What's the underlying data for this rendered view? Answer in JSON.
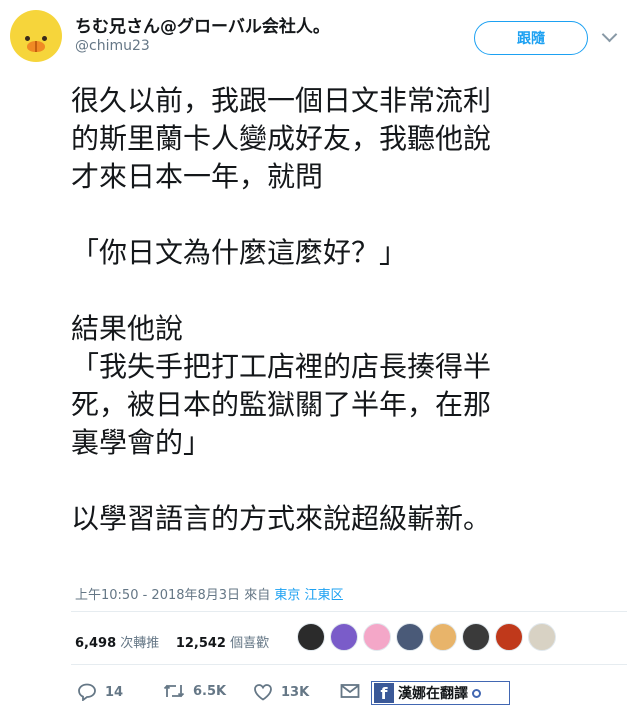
{
  "tweet": {
    "author_name": "ちむ兄さん@グローバル会社人。",
    "author_handle": "@chimu23",
    "follow_label": "跟隨",
    "body": "很久以前，我跟一個日文非常流利\n的斯里蘭卡人變成好友，我聽他說\n才來日本一年，就問\n\n「你日文為什麼這麼好？」\n\n結果他說\n「我失手把打工店裡的店長揍得半\n死，被日本的監獄關了半年，在那\n裏學會的」\n\n以學習語言的方式來說超級嶄新。",
    "timestamp": "上午10:50 - 2018年8月3日",
    "from_label": "來自",
    "location": "東京 江東区"
  },
  "stats": {
    "retweets_count": "6,498",
    "retweets_label": "次轉推",
    "likes_count": "12,542",
    "likes_label": "個喜歡"
  },
  "likers": [
    "#2b2b2b",
    "#7a5cc9",
    "#f4a7c8",
    "#4a5a78",
    "#e8b46a",
    "#3a3a3a",
    "#c0391b",
    "#d8d2c4"
  ],
  "actions": {
    "reply_count": "14",
    "retweet_count": "6.5K",
    "like_count": "13K"
  },
  "watermark": {
    "text": "漢娜在翻譯",
    "badge": "f"
  },
  "colors": {
    "accent": "#1da1f2",
    "muted": "#657786",
    "avatar_bg": "#f6d53b"
  }
}
